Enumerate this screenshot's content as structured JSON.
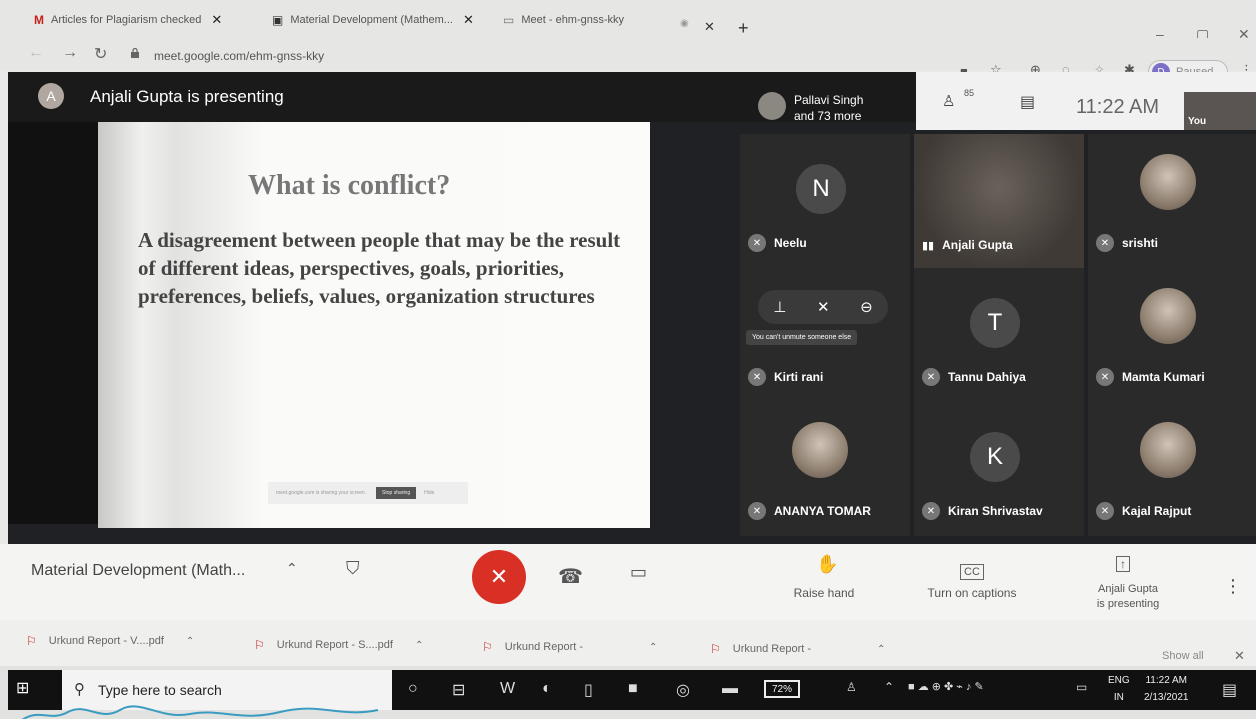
{
  "browser": {
    "tabs": [
      {
        "icon": "M",
        "label": "Articles for Plagiarism checked"
      },
      {
        "icon": "▣",
        "label": "Material Development (Mathem..."
      },
      {
        "icon": "▭",
        "label": "Meet - ehm-gnss-kky"
      }
    ],
    "url": "meet.google.com/ehm-gnss-kky",
    "profile_initial": "D",
    "profile_status": "Paused"
  },
  "meet": {
    "presenter_initial": "A",
    "presenter_text": "Anjali Gupta is presenting",
    "pallavi_line1": "Pallavi Singh",
    "pallavi_line2": "and 73 more",
    "people_count": "85",
    "clock": "11:22 AM",
    "self_label": "You",
    "slide": {
      "title": "What is conflict?",
      "body": "A disagreement between people that may be the result of different ideas, perspectives, goals, priorities, preferences, beliefs, values, organization structures",
      "share_text": "meet.google.com is sharing your screen.",
      "stop_label": "Stop sharing",
      "hide_label": "Hide"
    },
    "participants": [
      {
        "name": "Neelu",
        "initial": "N",
        "color": "#4a4a4a",
        "type": "initial"
      },
      {
        "name": "Anjali Gupta",
        "type": "video"
      },
      {
        "name": "srishti",
        "type": "photo"
      },
      {
        "name": "Kirti rani",
        "type": "hover"
      },
      {
        "name": "Tannu Dahiya",
        "initial": "T",
        "color": "#4a4a4a",
        "type": "initial"
      },
      {
        "name": "Mamta Kumari",
        "type": "photo"
      },
      {
        "name": "ANANYA TOMAR",
        "type": "photo"
      },
      {
        "name": "Kiran Shrivastav",
        "initial": "K",
        "color": "#4a4a4a",
        "type": "initial"
      },
      {
        "name": "Kajal Rajput",
        "type": "photo"
      }
    ],
    "tooltip": "You can't unmute someone else"
  },
  "controls": {
    "meeting_title": "Material Development (Math...",
    "raise_hand": "Raise hand",
    "captions": "Turn on captions",
    "presenting_line1": "Anjali Gupta",
    "presenting_line2": "is presenting"
  },
  "downloads": {
    "items": [
      "Urkund Report - V....pdf",
      "Urkund Report - S....pdf",
      "Urkund Report -",
      "Urkund Report -"
    ],
    "show_all": "Show all"
  },
  "taskbar": {
    "search_placeholder": "Type here to search",
    "battery": "72%",
    "lang1": "ENG",
    "lang2": "IN",
    "time": "11:22 AM",
    "date": "2/13/2021"
  }
}
